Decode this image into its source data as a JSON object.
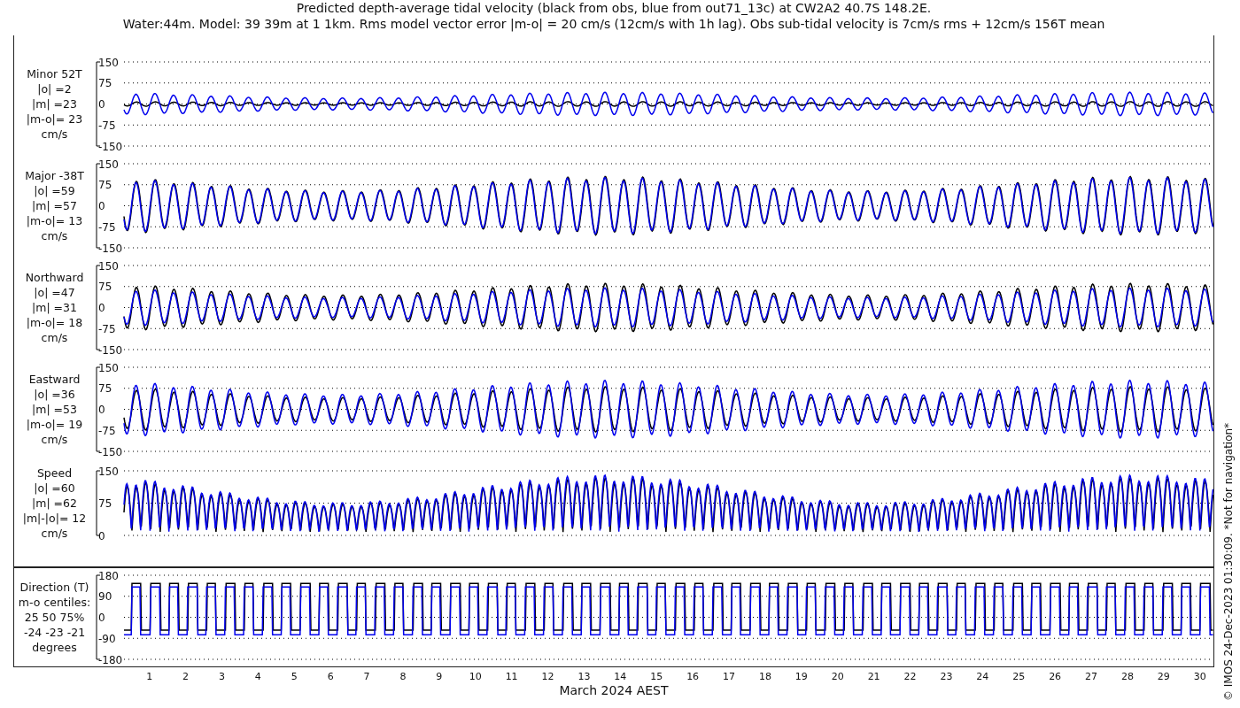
{
  "title_lines": [
    "Predicted depth-average tidal velocity (black from obs, blue from out71_13c) at CW2A2 40.7S 148.2E.",
    "Water:44m. Model: 39 39m at 1 1km. Rms model vector error |m-o| = 20 cm/s (12cm/s with 1h lag). Obs sub-tidal velocity is 7cm/s rms + 12cm/s 156T mean"
  ],
  "panels": [
    {
      "kind": "signed",
      "label_lines": [
        "Minor 52T",
        "|o| =2",
        "|m| =23",
        "|m-o|= 23",
        "cm/s"
      ],
      "yticks": [
        "150",
        "75",
        "0",
        "-75",
        "-150"
      ]
    },
    {
      "kind": "signed",
      "label_lines": [
        "Major -38T",
        "|o| =59",
        "|m| =57",
        "|m-o|= 13",
        "cm/s"
      ],
      "yticks": [
        "150",
        "75",
        "0",
        "-75",
        "-150"
      ]
    },
    {
      "kind": "signed",
      "label_lines": [
        "Northward",
        "|o| =47",
        "|m| =31",
        "|m-o|= 18",
        "cm/s"
      ],
      "yticks": [
        "150",
        "75",
        "0",
        "-75",
        "-150"
      ]
    },
    {
      "kind": "signed",
      "label_lines": [
        "Eastward",
        "|o| =36",
        "|m| =53",
        "|m-o|= 19",
        "cm/s"
      ],
      "yticks": [
        "150",
        "75",
        "0",
        "-75",
        "-150"
      ]
    },
    {
      "kind": "speed",
      "label_lines": [
        "Speed",
        "|o| =60",
        "|m| =62",
        "|m|-|o|= 12",
        "cm/s"
      ],
      "yticks": [
        "150",
        "75",
        "0"
      ]
    },
    {
      "kind": "direction",
      "label_lines": [
        "Direction (T)",
        "m-o centiles:",
        "25  50  75%",
        "-24 -23 -21",
        "degrees"
      ],
      "yticks": [
        "180",
        "90",
        "0",
        "-90",
        "-180"
      ]
    }
  ],
  "xticks": [
    "1",
    "2",
    "3",
    "4",
    "5",
    "6",
    "7",
    "8",
    "9",
    "10",
    "11",
    "12",
    "13",
    "14",
    "15",
    "16",
    "17",
    "18",
    "19",
    "20",
    "21",
    "22",
    "23",
    "24",
    "25",
    "26",
    "27",
    "28",
    "29",
    "30"
  ],
  "xlabel": "March 2024 AEST",
  "credit": "© IMOS 24-Dec-2023 01:30:09.  *Not for navigation*"
}
